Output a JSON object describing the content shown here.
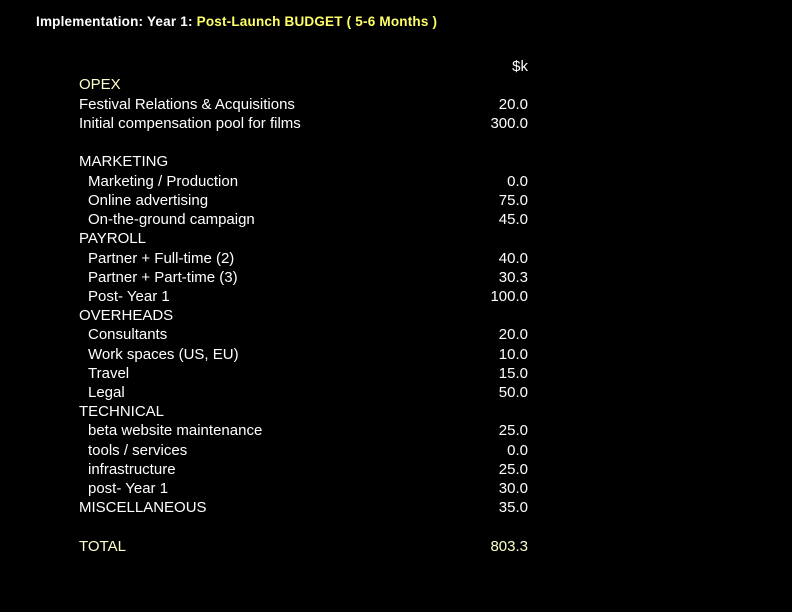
{
  "title": {
    "prefix": "Implementation: Year 1: ",
    "highlight": "Post-Launch BUDGET ( 5-6 Months )"
  },
  "unit": "$k",
  "rows": [
    {
      "label": "OPEX",
      "value": "",
      "type": "header-accent"
    },
    {
      "label": "Festival Relations & Acquisitions",
      "value": "20.0",
      "type": "item"
    },
    {
      "label": "Initial compensation pool for films",
      "value": "300.0",
      "type": "item"
    },
    {
      "label": "MARKETING",
      "value": "",
      "type": "header"
    },
    {
      "label": "Marketing / Production",
      "value": "0.0",
      "type": "sub"
    },
    {
      "label": "Online advertising",
      "value": "75.0",
      "type": "sub"
    },
    {
      "label": "On-the-ground campaign",
      "value": "45.0",
      "type": "sub"
    },
    {
      "label": "PAYROLL",
      "value": "",
      "type": "header"
    },
    {
      "label": "Partner + Full-time (2)",
      "value": "40.0",
      "type": "sub"
    },
    {
      "label": "Partner + Part-time (3)",
      "value": "30.3",
      "type": "sub"
    },
    {
      "label": "Post- Year 1",
      "value": "100.0",
      "type": "sub"
    },
    {
      "label": "OVERHEADS",
      "value": "",
      "type": "header"
    },
    {
      "label": "Consultants",
      "value": "20.0",
      "type": "sub"
    },
    {
      "label": "Work spaces (US, EU)",
      "value": "10.0",
      "type": "sub"
    },
    {
      "label": "Travel",
      "value": "15.0",
      "type": "sub"
    },
    {
      "label": "Legal",
      "value": "50.0",
      "type": "sub"
    },
    {
      "label": "TECHNICAL",
      "value": "",
      "type": "header"
    },
    {
      "label": "beta website maintenance",
      "value": "25.0",
      "type": "sub"
    },
    {
      "label": "tools / services",
      "value": "0.0",
      "type": "sub"
    },
    {
      "label": "infrastructure",
      "value": "25.0",
      "type": "sub"
    },
    {
      "label": "post- Year 1",
      "value": "30.0",
      "type": "sub"
    },
    {
      "label": "MISCELLANEOUS",
      "value": "35.0",
      "type": "header"
    }
  ],
  "total": {
    "label": "TOTAL",
    "value": "803.3"
  },
  "colors": {
    "background": "#000000",
    "text": "#ffffff",
    "highlight": "#ffff66",
    "accent": "#ffffcc"
  }
}
